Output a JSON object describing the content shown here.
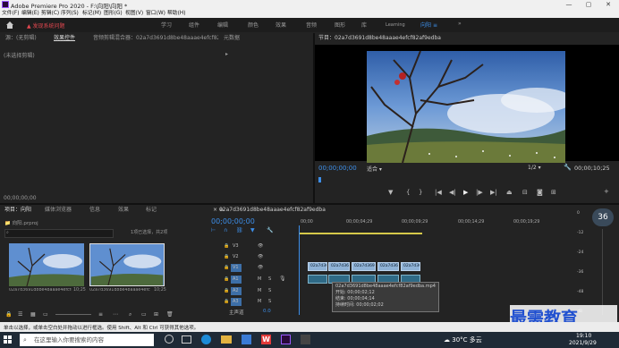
{
  "window": {
    "title": "Adobe Premiere Pro 2020 - F:\\向阳\\向阳 *",
    "minimize": "—",
    "maximize": "▢",
    "close": "✕"
  },
  "menu": [
    "文件(F)",
    "编辑(E)",
    "剪辑(C)",
    "序列(S)",
    "标记(M)",
    "图形(G)",
    "视图(V)",
    "窗口(W)",
    "帮助(H)"
  ],
  "workspaces": [
    "学习",
    "组件",
    "编辑",
    "颜色",
    "效果",
    "音频",
    "图形",
    "库",
    "Learning",
    "向阳"
  ],
  "workspace_active_suffix": "≡",
  "workspace_more": "»",
  "warning": "发现系统问题",
  "source_panel": {
    "tabs": [
      "源：(无剪辑)",
      "效果控件",
      "音频剪辑混合器：02a7d3691d8be48aaae4efcf82af9edba",
      "元数据"
    ],
    "empty_msg": "(未选择剪辑)",
    "more": "▸",
    "timecode": "00;00;00;00"
  },
  "program": {
    "title": "节目：02a7d3691d8be48aaae4efcf82af9edba",
    "timecode": "00;00;00;00",
    "fit": "适合",
    "ratio": "1/2",
    "duration": "00;00;10;25"
  },
  "project": {
    "tabs": [
      "项目：向阳",
      "媒体浏览器",
      "信息",
      "效果",
      "标记"
    ],
    "file": "向阳.prproj",
    "selection": "1项已选择，共2项",
    "items": [
      {
        "name": "02a7d3691d8be48aaae4efcf82...",
        "dur": "10;25"
      },
      {
        "name": "02a7d3691d8be48aaae4efcf8...",
        "dur": "10;25"
      }
    ]
  },
  "sequence": {
    "tab": "02a7d3691d8be48aaae4efcf82af9edba",
    "timecode": "00;00;00;00",
    "ruler": [
      "00;00",
      "00;00;04;29",
      "00;00;09;29",
      "00;00;14;29",
      "00;00;19;29"
    ],
    "tracks_v": [
      "V3",
      "V2",
      "V1"
    ],
    "tracks_a": [
      "A1",
      "A2",
      "A3"
    ],
    "master": "主声道",
    "master_val": "0.0",
    "clip_label": "02a7d369",
    "tooltip": [
      "02a7d3691d8be48aaae4efcf82af9edba.mp4",
      "开始: 00;00;02;12",
      "结束: 00;00;04;14",
      "持续时间: 00;00;02;02"
    ]
  },
  "status": "单击以选择，或单击空白处并拖动以进行框选。使用 Shift、Alt 和 Ctrl 可获得其他选项。",
  "taskbar": {
    "search": "在这里输入你要搜索的内容",
    "weather": "30°C 多云",
    "time": "19:10",
    "date": "2021/9/29"
  },
  "watermark": "最需教育",
  "volume_badge": "36",
  "db": [
    "0",
    "-12",
    "-24",
    "-36",
    "-48",
    "dB"
  ],
  "colors": {
    "accent": "#3d8ee8",
    "warn": "#e34850",
    "clip_video": "#8fb2d6",
    "clip_audio": "#2f6a86"
  }
}
